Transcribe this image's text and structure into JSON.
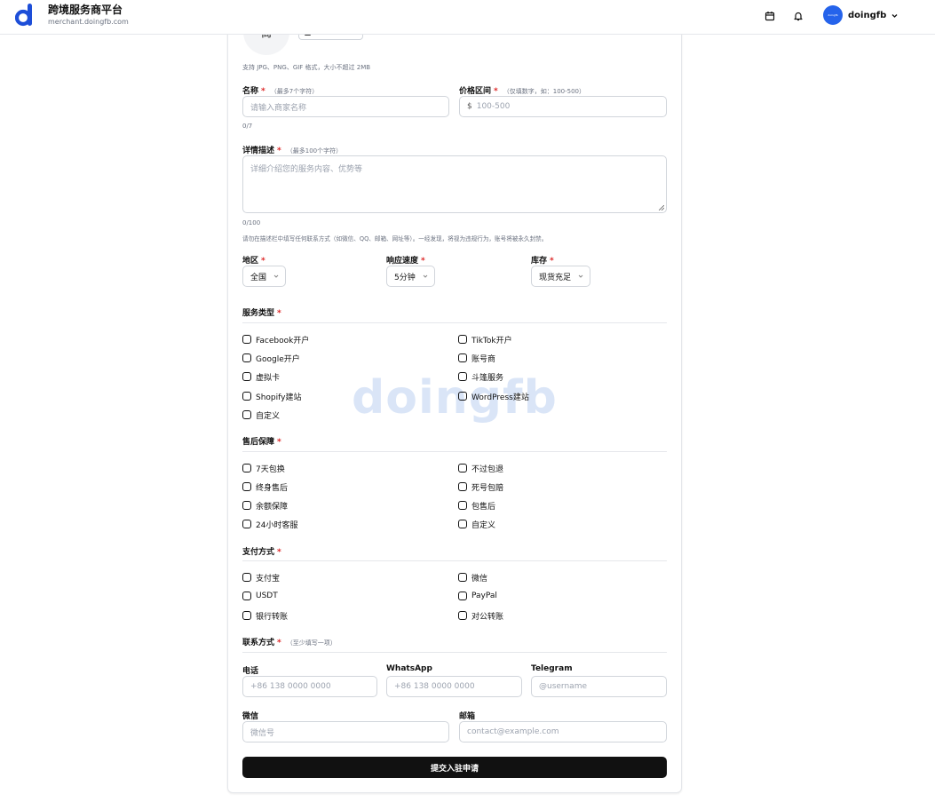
{
  "header": {
    "title": "跨境服务商平台",
    "subtitle": "merchant.doingfb.com",
    "user_name": "doingfb",
    "avatar_text": "doingfb",
    "icons": [
      "calendar-icon",
      "bell-icon",
      "chevron-down-icon"
    ],
    "accent_color": "#2563eb"
  },
  "upload": {
    "avatar_char": "商",
    "button_label": "上传图片",
    "hint": "支持 JPG、PNG、GIF 格式，大小不超过 2MB"
  },
  "form": {
    "name": {
      "label": "名称",
      "required": "*",
      "hint": "（最多7个字符）",
      "placeholder": "请输入商家名称",
      "counter": "0/7"
    },
    "price": {
      "label": "价格区间",
      "required": "*",
      "hint": "（仅填数字，如：100-500）",
      "prefix": "$",
      "placeholder": "100-500"
    },
    "desc": {
      "label": "详情描述",
      "required": "*",
      "hint": "（最多100个字符）",
      "placeholder": "详细介绍您的服务内容、优势等",
      "counter": "0/100",
      "warning": "请勿在描述栏中填写任何联系方式（如微信、QQ、邮箱、网址等）。一经发现，将视为违规行为，账号将被永久封禁。"
    },
    "region": {
      "label": "地区",
      "required": "*",
      "value": "全国"
    },
    "speed": {
      "label": "响应速度",
      "required": "*",
      "value": "5分钟"
    },
    "stock": {
      "label": "库存",
      "required": "*",
      "value": "现货充足"
    }
  },
  "service_types": {
    "title": "服务类型",
    "required": "*",
    "options": [
      "Facebook开户",
      "TikTok开户",
      "Google开户",
      "账号商",
      "虚拟卡",
      "斗篷服务",
      "Shopify建站",
      "WordPress建站",
      "自定义"
    ]
  },
  "after_sales": {
    "title": "售后保障",
    "required": "*",
    "options": [
      "7天包换",
      "不过包退",
      "终身售后",
      "死号包赔",
      "余额保障",
      "包售后",
      "24小时客服",
      "自定义"
    ]
  },
  "payment": {
    "title": "支付方式",
    "required": "*",
    "options": [
      "支付宝",
      "微信",
      "USDT",
      "PayPal",
      "银行转账",
      "对公转账"
    ]
  },
  "contact": {
    "title": "联系方式",
    "required": "*",
    "hint": "（至少填写一项）",
    "phone": {
      "label": "电话",
      "placeholder": "+86 138 0000 0000"
    },
    "whatsapp": {
      "label": "WhatsApp",
      "placeholder": "+86 138 0000 0000"
    },
    "telegram": {
      "label": "Telegram",
      "placeholder": "@username"
    },
    "wechat": {
      "label": "微信",
      "placeholder": "微信号"
    },
    "email": {
      "label": "邮箱",
      "placeholder": "contact@example.com"
    }
  },
  "submit_label": "提交入驻申请",
  "watermark": "doingfb"
}
